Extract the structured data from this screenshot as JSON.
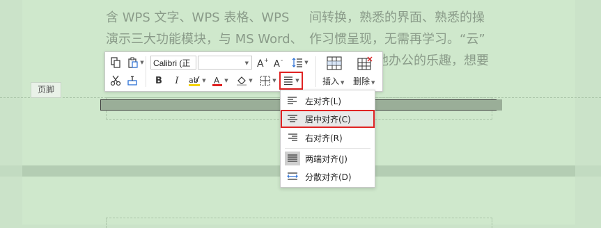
{
  "document": {
    "left_column": [
      "含 WPS 文字、WPS 表格、WPS",
      "演示三大功能模块，与 MS Word、"
    ],
    "right_column": [
      "间转换，熟悉的界面、熟悉的操",
      "作习惯呈现，无需再学习。“云”",
      "他办公的乐趣，想要"
    ],
    "footer_label": "页脚"
  },
  "toolbar": {
    "font_name": "Calibri (正",
    "font_size": "",
    "insert_label": "插入",
    "delete_label": "删除"
  },
  "align_menu": {
    "items": [
      {
        "label": "左对齐(L)"
      },
      {
        "label": "居中对齐(C)"
      },
      {
        "label": "右对齐(R)"
      },
      {
        "label": "两端对齐(J)"
      },
      {
        "label": "分散对齐(D)"
      }
    ]
  },
  "colors": {
    "highlight_border": "#e02323",
    "page_background": "#cfe8cc",
    "font_color_underline": "#e02323",
    "highlight_color_underline": "#f5d40a"
  }
}
